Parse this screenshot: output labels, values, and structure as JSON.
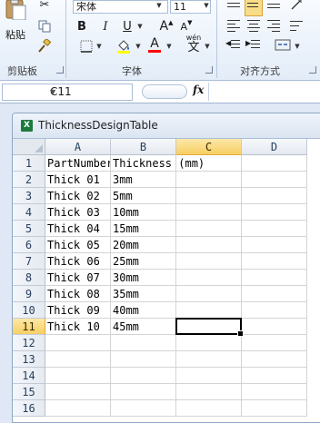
{
  "ribbon": {
    "clipboard": {
      "paste_label": "粘贴",
      "group_label": "剪贴板"
    },
    "font": {
      "font_name": "宋体",
      "font_size": "11",
      "grow_label": "A",
      "shrink_label": "A",
      "bold_label": "B",
      "italic_label": "I",
      "underline_label": "U",
      "font_color_label": "A",
      "phonetic_label": "wén",
      "phonetic_char": "文",
      "group_label": "字体",
      "highlight_color": "#ffff00",
      "font_color": "#ff0000"
    },
    "alignment": {
      "group_label": "对齐方式"
    }
  },
  "formula_bar": {
    "name_box": "C11",
    "fx_label": "fx",
    "formula": ""
  },
  "workbook": {
    "title": "ThicknessDesignTable",
    "icon_label": "X",
    "columns": [
      "A",
      "B",
      "C",
      "D"
    ],
    "rows": [
      {
        "num": "1",
        "a": "PartNumber",
        "b": "Thickness (mm)"
      },
      {
        "num": "2",
        "a": "Thick 01",
        "b": "3mm"
      },
      {
        "num": "3",
        "a": "Thick 02",
        "b": "5mm"
      },
      {
        "num": "4",
        "a": "Thick 03",
        "b": "10mm"
      },
      {
        "num": "5",
        "a": "Thick 04",
        "b": "15mm"
      },
      {
        "num": "6",
        "a": "Thick 05",
        "b": "20mm"
      },
      {
        "num": "7",
        "a": "Thick 06",
        "b": "25mm"
      },
      {
        "num": "8",
        "a": "Thick 07",
        "b": "30mm"
      },
      {
        "num": "9",
        "a": "Thick 08",
        "b": "35mm"
      },
      {
        "num": "10",
        "a": "Thick 09",
        "b": "40mm"
      },
      {
        "num": "11",
        "a": "Thick 10",
        "b": "45mm"
      },
      {
        "num": "12",
        "a": "",
        "b": ""
      },
      {
        "num": "13",
        "a": "",
        "b": ""
      },
      {
        "num": "14",
        "a": "",
        "b": ""
      },
      {
        "num": "15",
        "a": "",
        "b": ""
      },
      {
        "num": "16",
        "a": "",
        "b": ""
      }
    ],
    "active_column": "C",
    "active_row": "11"
  }
}
